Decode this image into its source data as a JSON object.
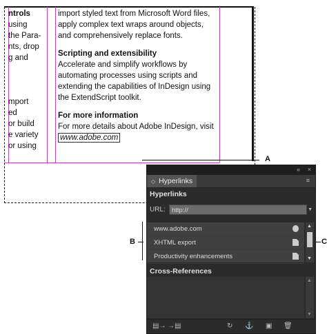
{
  "document": {
    "colA_lines": [
      "ntrols",
      "using",
      "the Para-",
      "nts, drop",
      "g and",
      "",
      "",
      "mport",
      "ed",
      "or build",
      "e variety",
      "or using"
    ],
    "colB": {
      "intro": "import styled text from Microsoft Word files, apply complex text wraps around objects, and comprehensively replace fonts.",
      "heading1": "Scripting and extensibility",
      "para1": "Accelerate and simplify workflows by automating processes using scripts and extending the capabilities of InDesign using the ExtendScript toolkit.",
      "heading2": "For more information",
      "para2_prefix": "For more details about Adobe InDesign, visit",
      "link_text": "www.adobe.com"
    }
  },
  "callouts": {
    "a": "A",
    "b": "B",
    "c": "C"
  },
  "panel": {
    "collapse_icon": "«",
    "close_icon": "×",
    "tab_label": "Hyperlinks",
    "tab_chevron": "◇",
    "menu_icon": "≡",
    "section_title": "Hyperlinks",
    "url_label": "URL:",
    "url_value": "http://",
    "items": [
      {
        "label": "www.adobe.com",
        "status_icon": "globe-icon"
      },
      {
        "label": "XHTML export",
        "status_icon": "page-icon"
      },
      {
        "label": "Productivity enhancements",
        "status_icon": "page-icon"
      }
    ],
    "xref_title": "Cross-References"
  }
}
